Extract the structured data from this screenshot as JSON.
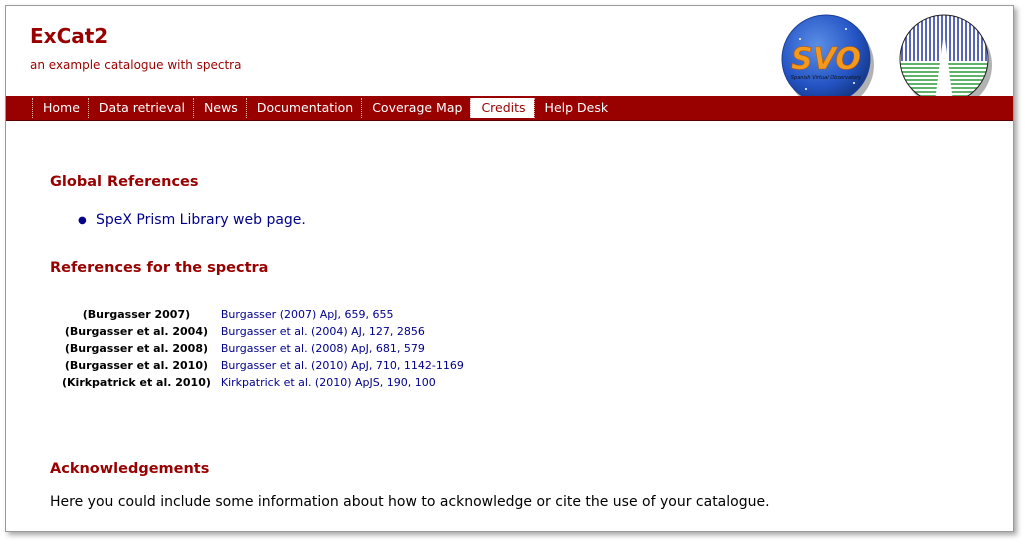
{
  "header": {
    "title": "ExCat2",
    "subtitle": "an example catalogue with spectra",
    "svo_logo_text": "SVO",
    "svo_logo_subtext": "Spanish Virtual Observatory"
  },
  "nav": {
    "items": [
      {
        "label": "Home",
        "active": false
      },
      {
        "label": "Data retrieval",
        "active": false
      },
      {
        "label": "News",
        "active": false
      },
      {
        "label": "Documentation",
        "active": false
      },
      {
        "label": "Coverage Map",
        "active": false
      },
      {
        "label": "Credits",
        "active": true
      },
      {
        "label": "Help Desk",
        "active": false
      }
    ]
  },
  "global_refs": {
    "title": "Global References",
    "items": [
      "SpeX Prism Library web page."
    ]
  },
  "spectra_refs": {
    "title": "References for the spectra",
    "rows": [
      {
        "key": "(Burgasser 2007)",
        "link": "Burgasser (2007) ApJ, 659, 655"
      },
      {
        "key": "(Burgasser et al. 2004)",
        "link": "Burgasser et al. (2004) AJ, 127, 2856"
      },
      {
        "key": "(Burgasser et al. 2008)",
        "link": "Burgasser et al. (2008) ApJ, 681, 579"
      },
      {
        "key": "(Burgasser et al. 2010)",
        "link": "Burgasser et al. (2010) ApJ, 710, 1142-1169"
      },
      {
        "key": "(Kirkpatrick et al. 2010)",
        "link": "Kirkpatrick et al. (2010) ApJS, 190, 100"
      }
    ]
  },
  "acknowledgements": {
    "title": "Acknowledgements",
    "text": "Here you could include some information about how to acknowledge or cite the use of your catalogue."
  },
  "colors": {
    "brand": "#990000",
    "link": "#00008b"
  }
}
